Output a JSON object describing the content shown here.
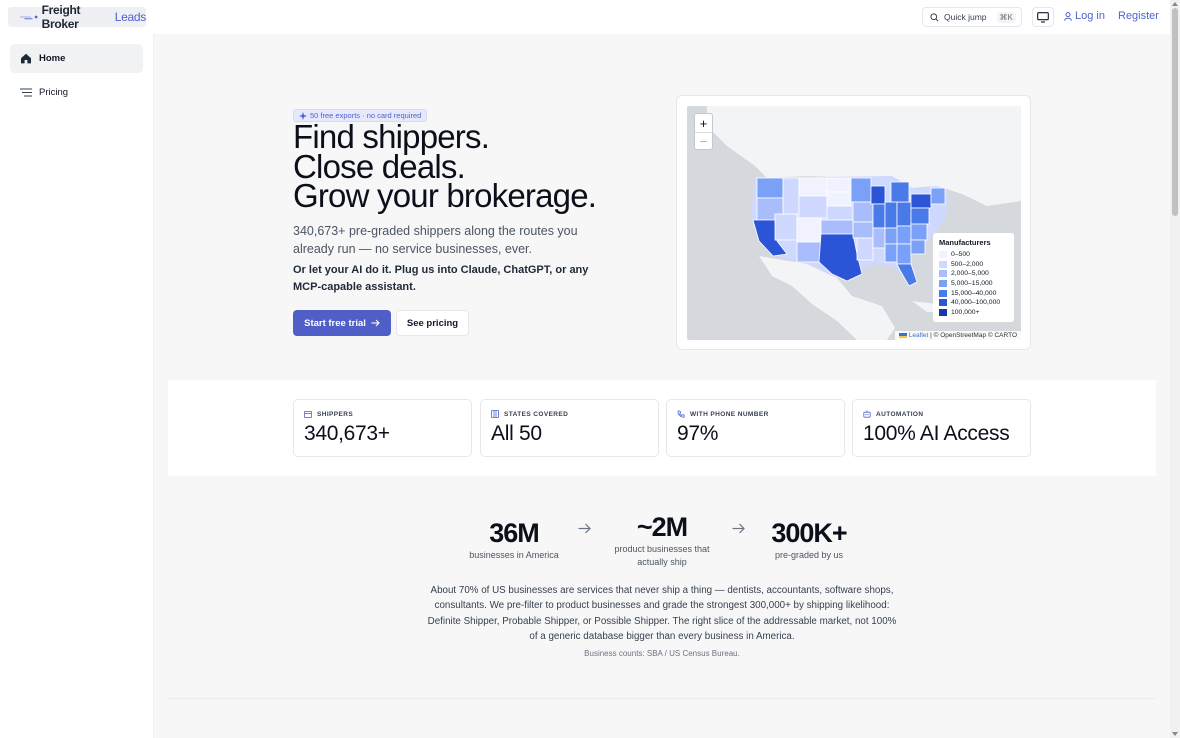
{
  "header": {
    "logo_part1": "Freight Broker",
    "logo_part2": "Leads",
    "quick_jump_label": "Quick jump",
    "quick_jump_shortcut": "⌘K",
    "login_label": "Log in",
    "register_label": "Register"
  },
  "sidebar": {
    "items": [
      {
        "label": "Home",
        "icon": "home-icon",
        "active": true
      },
      {
        "label": "Pricing",
        "icon": "list-icon",
        "active": false
      }
    ]
  },
  "hero": {
    "badge": "50 free exports · no card required",
    "title_lines": [
      "Find shippers.",
      "Close deals.",
      "Grow your brokerage."
    ],
    "subtitle": "340,673+ pre-graded shippers along the routes you already run — no service businesses, ever.",
    "ai_line": "Or let your AI do it. Plug us into Claude, ChatGPT, or any MCP-capable assistant.",
    "primary_cta": "Start free trial",
    "secondary_cta": "See pricing"
  },
  "map": {
    "zoom_in": "+",
    "zoom_out": "−",
    "legend_title": "Manufacturers",
    "legend": [
      {
        "label": "0–500",
        "color": "#f0f3ff"
      },
      {
        "label": "500–2,000",
        "color": "#cfd8ff"
      },
      {
        "label": "2,000–5,000",
        "color": "#a9bdfc"
      },
      {
        "label": "5,000–15,000",
        "color": "#7aa0f7"
      },
      {
        "label": "15,000–40,000",
        "color": "#4a7ae8"
      },
      {
        "label": "40,000–100,000",
        "color": "#2b55d6"
      },
      {
        "label": "100,000+",
        "color": "#1a37a8"
      }
    ],
    "attribution_leaflet": "Leaflet",
    "attribution_rest": " | © OpenStreetMap © CARTO"
  },
  "stats": [
    {
      "label": "SHIPPERS",
      "value": "340,673+",
      "icon": "building-icon"
    },
    {
      "label": "STATES COVERED",
      "value": "All 50",
      "icon": "map-icon"
    },
    {
      "label": "WITH PHONE NUMBER",
      "value": "97%",
      "icon": "phone-icon"
    },
    {
      "label": "AUTOMATION",
      "value": "100% AI Access",
      "icon": "robot-icon"
    }
  ],
  "funnel": [
    {
      "value": "36M",
      "caption": "businesses in America"
    },
    {
      "value": "~2M",
      "caption": "product businesses that actually ship"
    },
    {
      "value": "300K+",
      "caption": "pre-graded by us"
    }
  ],
  "explanation": "About 70% of US businesses are services that never ship a thing — dentists, accountants, software shops, consultants. We pre-filter to product businesses and grade the strongest 300,000+ by shipping likelihood: Definite Shipper, Probable Shipper, or Possible Shipper. The right slice of the addressable market, not 100% of a generic database bigger than every business in America.",
  "source": "Business counts: SBA / US Census Bureau.",
  "colors": {
    "accent": "#4f63d2",
    "primary_button": "#4f5fc7",
    "background": "#f7f7f8"
  }
}
